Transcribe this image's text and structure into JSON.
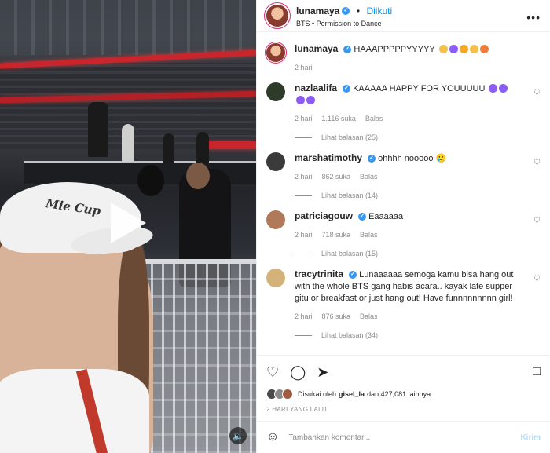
{
  "post": {
    "username": "lunamaya",
    "follow_status": "Diikuti",
    "separator": "•",
    "audio": "BTS • Permission to Dance",
    "caption": "HAAAPPPPPYYYYY",
    "caption_emojis": [
      "#f5c04a",
      "#8b5cf6",
      "#f5a623",
      "#f5c04a",
      "#f07e3a"
    ],
    "caption_time": "2 hari",
    "video_cap_text": "Mie Cup"
  },
  "comments": [
    {
      "username": "nazlaalifa",
      "text": "KAAAAA HAPPY FOR YOUUUUU",
      "emojis": [
        "#8b5cf6",
        "#8b5cf6",
        "#8b5cf6",
        "#8b5cf6"
      ],
      "time": "2 hari",
      "likes": "1.116 suka",
      "reply": "Balas",
      "replies": "Lihat balasan (25)",
      "avatar_color": "#2f3b2a"
    },
    {
      "username": "marshatimothy",
      "text": "ohhhh nooooo 🥲",
      "emojis": [],
      "time": "2 hari",
      "likes": "862 suka",
      "reply": "Balas",
      "replies": "Lihat balasan (14)",
      "avatar_color": "#3a3a3a"
    },
    {
      "username": "patriciagouw",
      "text": "Eaaaaaa",
      "emojis": [],
      "time": "2 hari",
      "likes": "718 suka",
      "reply": "Balas",
      "replies": "Lihat balasan (15)",
      "avatar_color": "#b07a5a"
    },
    {
      "username": "tracytrinita",
      "text": "Lunaaaaaa semoga kamu bisa hang out with the whole BTS gang habis acara.. kayak late supper gitu or breakfast or just hang out! Have funnnnnnnnn girl!",
      "emojis": [],
      "time": "2 hari",
      "likes": "876 suka",
      "reply": "Balas",
      "replies": "Lihat balasan (34)",
      "avatar_color": "#d4b37a"
    }
  ],
  "actions": {
    "icons": [
      "heart-icon",
      "comment-icon",
      "share-icon",
      "bookmark-icon"
    ]
  },
  "likes": {
    "prefix": "Disukai oleh",
    "user": "gisel_la",
    "suffix": "dan 427,081 lainnya"
  },
  "date": "2 HARI YANG LALU",
  "add_comment": {
    "placeholder": "Tambahkan komentar...",
    "post_label": "Kirim"
  },
  "colors": {
    "link_blue": "#0095f6",
    "verified_blue": "#3897f0",
    "muted": "#8e8e8e",
    "post_disabled": "#b2dffc"
  }
}
